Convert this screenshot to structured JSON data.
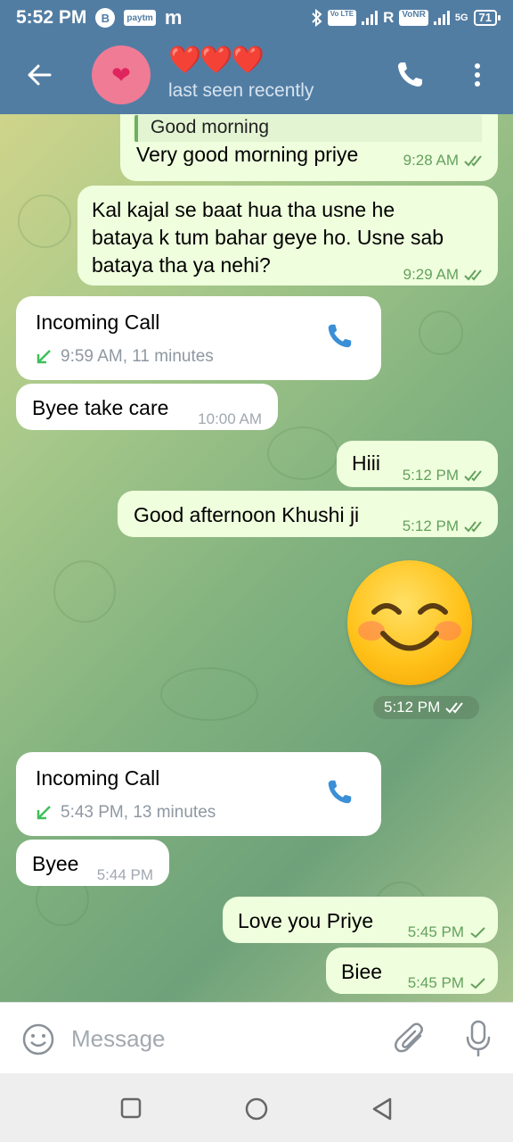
{
  "status_bar": {
    "time": "5:52 PM",
    "app_badge_1": "B",
    "app_badge_2": "paytm",
    "app_badge_3": "m",
    "volte_1": "Vo LTE",
    "carrier_r": "R",
    "vonr": "VoNR",
    "network": "5G",
    "battery": "71"
  },
  "header": {
    "title": "❤️❤️❤️",
    "status": "last seen recently",
    "avatar_symbol": "❤"
  },
  "messages": [
    {
      "type": "out",
      "reply_quote": "Good morning",
      "text": "Very good morning priye",
      "time": "9:28 AM",
      "ticks": "double"
    },
    {
      "type": "out",
      "lines": [
        "Kal kajal se baat hua tha usne he",
        "bataya k tum bahar geye ho. Usne sab",
        "bataya tha ya nehi?"
      ],
      "time": "9:29 AM",
      "ticks": "double"
    },
    {
      "type": "call",
      "title": "Incoming Call",
      "detail": "9:59 AM, 11 minutes"
    },
    {
      "type": "in",
      "text": "Byee take care",
      "time": "10:00 AM"
    },
    {
      "type": "out",
      "text": "Hiii",
      "time": "5:12 PM",
      "ticks": "double"
    },
    {
      "type": "out",
      "text": "Good afternoon Khushi ji",
      "time": "5:12 PM",
      "ticks": "double"
    },
    {
      "type": "sticker",
      "name": "smiling-face-emoji",
      "time": "5:12 PM"
    },
    {
      "type": "call",
      "title": "Incoming Call",
      "detail": "5:43 PM, 13 minutes"
    },
    {
      "type": "in",
      "text": "Byee",
      "time": "5:44 PM"
    },
    {
      "type": "out",
      "text": "Love you Priye",
      "time": "5:45 PM",
      "ticks": "single"
    },
    {
      "type": "out",
      "text": "Biee",
      "time": "5:45 PM",
      "ticks": "single"
    }
  ],
  "input": {
    "placeholder": "Message"
  },
  "colors": {
    "header": "#527da3",
    "outgoing_bubble": "#effedd",
    "incoming_bubble": "#ffffff",
    "tick": "#64a15e",
    "call_icon": "#3a8fd6",
    "missed_arrow": "#3fbf5a"
  },
  "icons": [
    "back-arrow-icon",
    "phone-icon",
    "more-vertical-icon",
    "double-check-icon",
    "single-check-icon",
    "incoming-call-arrow-icon",
    "emoji-icon",
    "attach-icon",
    "microphone-icon",
    "nav-recents-icon",
    "nav-home-icon",
    "nav-back-icon"
  ]
}
